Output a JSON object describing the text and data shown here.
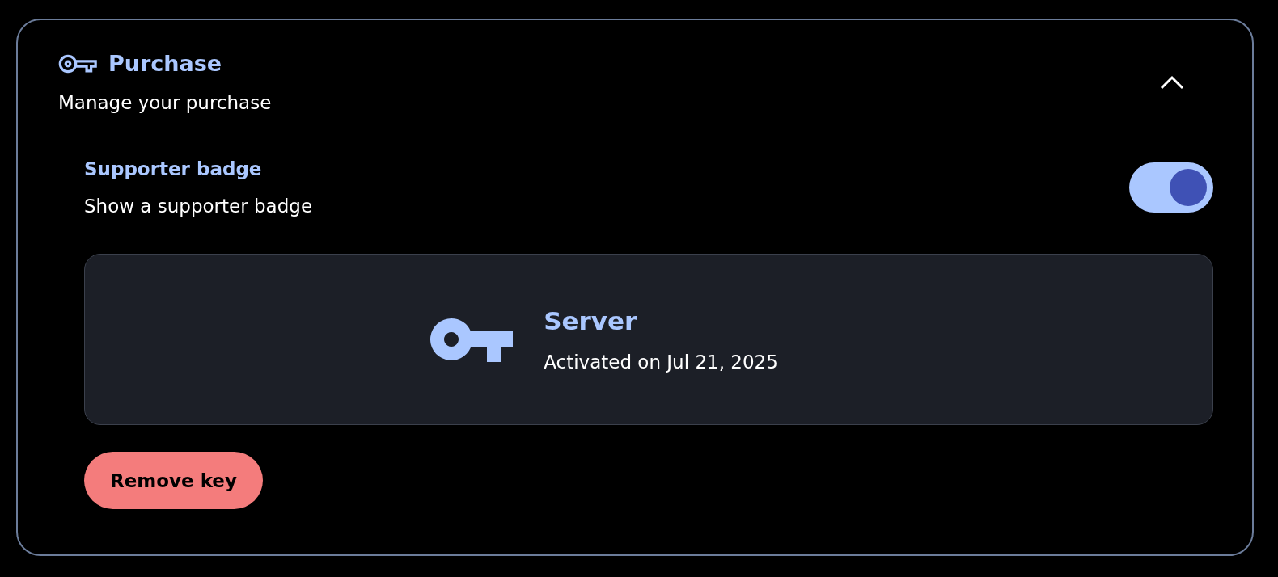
{
  "section": {
    "title": "Purchase",
    "subtitle": "Manage your purchase",
    "expanded": true
  },
  "setting": {
    "label": "Supporter badge",
    "description": "Show a supporter badge",
    "on": true
  },
  "license": {
    "name": "Server",
    "status": "Activated on Jul 21, 2025"
  },
  "buttons": [
    {
      "label": "Remove key"
    }
  ]
}
